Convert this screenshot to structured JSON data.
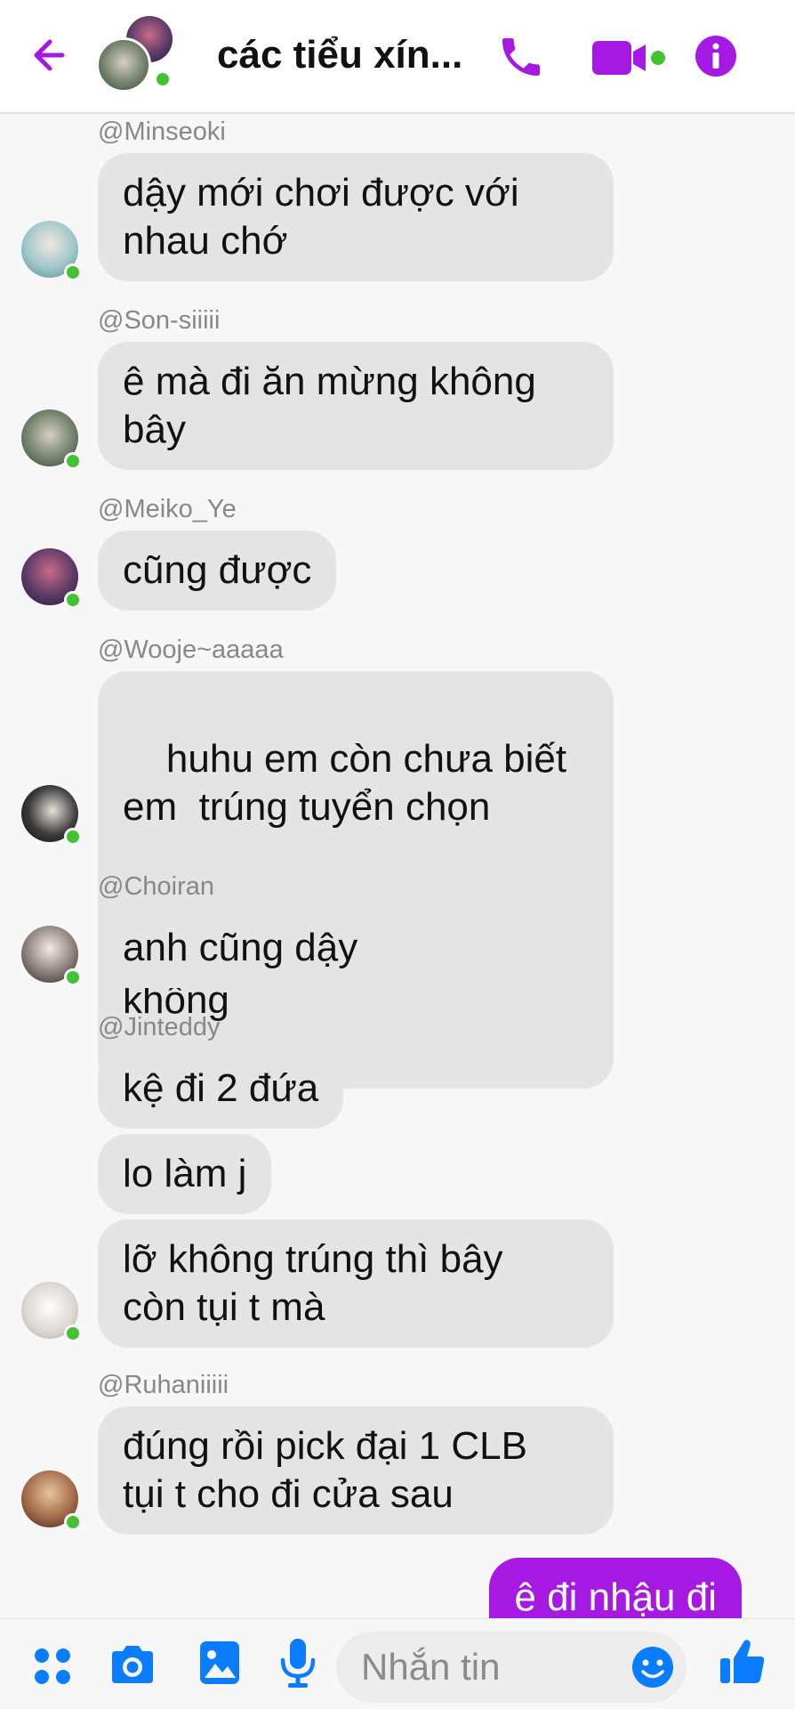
{
  "header": {
    "title": "các tiểu xín...",
    "accent": "#a519e3",
    "icons": [
      "back-arrow-icon",
      "phone-icon",
      "video-camera-icon",
      "info-icon"
    ]
  },
  "messages": [
    {
      "sender": "@Minseoki",
      "bubbles": [
        "dậy mới chơi được với\nnhau chớ"
      ]
    },
    {
      "sender": "@Son-siiiii",
      "bubbles": [
        "ê mà đi ăn mừng không\nbây"
      ]
    },
    {
      "sender": "@Meiko_Ye",
      "bubbles": [
        "cũng được"
      ]
    },
    {
      "sender": "@Wooje~aaaaa",
      "bubbles": [
        "huhu em còn chưa biết\nem  trúng tuyển chọn\nkhông "
      ]
    },
    {
      "sender": "@Choiran",
      "bubbles": [
        "anh cũng dậy"
      ]
    },
    {
      "sender": "@Jinteddy",
      "bubbles": [
        "kệ đi 2 đứa",
        "lo làm j",
        "lỡ không trúng thì bây\ncòn tụi t mà"
      ]
    },
    {
      "sender": "@Ruhaniiiii",
      "bubbles": [
        "đúng rồi pick đại 1 CLB\ntụi t cho đi cửa sau"
      ]
    }
  ],
  "outgoing": {
    "text": "ê đi nhậu đi"
  },
  "composer": {
    "placeholder": "Nhắn tin",
    "icons": [
      "menu-dots-icon",
      "camera-icon",
      "gallery-icon",
      "microphone-icon",
      "emoji-icon",
      "thumbs-up-icon"
    ],
    "icon_color": "#0a7cff"
  }
}
